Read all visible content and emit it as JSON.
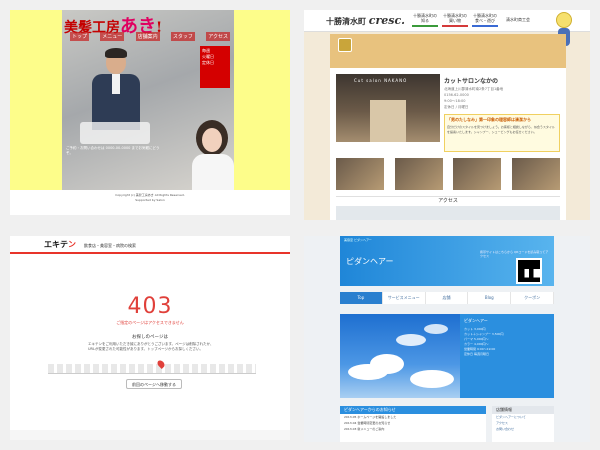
{
  "shot1": {
    "title_a": "美髪工房",
    "title_b": "あき",
    "title_c": "!",
    "nav": [
      "トップ",
      "メニュー",
      "店舗案内",
      "スタッフ",
      "アクセス"
    ],
    "badge": [
      "毎週",
      "火曜日",
      "定休日"
    ],
    "info": "ご予約・お問い合わせは 0000-00-0000 までお気軽にどうぞ。",
    "footer": [
      "Copyright (c) 美髪工房あき All Rights Reserved.",
      "Supported by Salon"
    ]
  },
  "shot2": {
    "town": "十勝清水町",
    "brand": "cresc.",
    "top_buttons": [
      {
        "label": "十勝清水町の 知る",
        "color": "#3a9a3a"
      },
      {
        "label": "十勝清水町の 買い物",
        "color": "#d43a3a"
      },
      {
        "label": "十勝清水町の 食べ・遊び",
        "color": "#3a6ad4"
      }
    ],
    "org": "清水町商工会",
    "app_label": "美容",
    "hero_sign": "Cut salon NAKANO",
    "shop_name": "カットサロンなかの",
    "addr": [
      "北海道上川郡清水町南2条7丁目1番地",
      "0156-62-0000",
      "9:00～18:00",
      "定休日 / 月曜日"
    ],
    "pr_head": "「男のたしなみ」第一印象の理容師は清潔から",
    "pr_body": "自分だけのスタイルを見つけましょう。お客様と相談しながら、似合うスタイルを提案いたします。シャンプー、シェービングもお任せください。",
    "access": "アクセス"
  },
  "shot3": {
    "logo_a": "エキテ",
    "logo_b": "ン",
    "tagline": "飲食店・美容室・病院の検索",
    "code": "403",
    "sub": "ご指定のページはアクセスできません",
    "msg_head": "お探しのページは",
    "msg": "エキテンをご利用いただき誠にありがとうございます。ページは削除されたか、URLが変更された可能性があります。トップページからお探しください。",
    "button": "前回のページへ移動する"
  },
  "shot4": {
    "small": "美容室 ピダンヘアー",
    "brand": "ピダンヘアー",
    "qr_info": "携帯サイトはこちらから QRコードを読み取ってアクセス",
    "tabs": [
      "Top",
      "サービスメニュー",
      "店舗",
      "Blog",
      "クーポン"
    ],
    "side_head": "ピダンヘアー",
    "side_lines": [
      "カット 3,000円",
      "カット＋シャンプー 3,500円",
      "パーマ 5,000円〜",
      "カラー 4,000円〜",
      "営業時間 9:00〜19:00",
      "定休日 毎週月曜日"
    ],
    "news_head": "ピダンヘアーからのお知らせ",
    "news_lines": [
      "2013.05 ホームページを開設しました",
      "2013.04 営業時間変更のお知らせ",
      "2013.03 新メニューのご案内"
    ],
    "box_head": "店舗情報",
    "box_lines": [
      "ピダンヘアーについて",
      "アクセス",
      "お問い合わせ"
    ]
  }
}
